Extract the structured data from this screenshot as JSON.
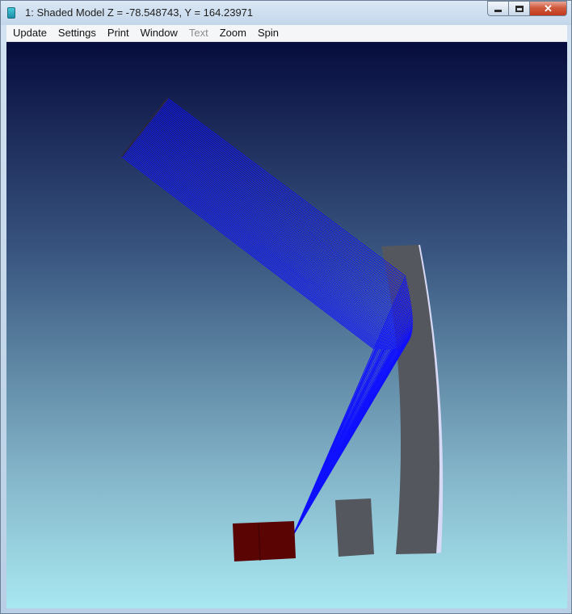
{
  "window": {
    "title": "1: Shaded Model Z = -78.548743, Y = 164.23971",
    "controls": {
      "minimize": "minimize",
      "maximize": "maximize",
      "close": "✕"
    }
  },
  "menu": {
    "items": [
      {
        "label": "Update",
        "enabled": true
      },
      {
        "label": "Settings",
        "enabled": true
      },
      {
        "label": "Print",
        "enabled": true
      },
      {
        "label": "Window",
        "enabled": true
      },
      {
        "label": "Text",
        "enabled": false
      },
      {
        "label": "Zoom",
        "enabled": true
      },
      {
        "label": "Spin",
        "enabled": true
      }
    ]
  },
  "scene": {
    "background_top": "#060d3d",
    "background_bottom": "#a8e8f1",
    "ray_color": "#1010ff",
    "mirror_color": "#55575f",
    "mirror_edge_color": "#d8d9f5",
    "detector_color": "#5a0404",
    "block_color": "#54575e",
    "ray_count": 48
  }
}
